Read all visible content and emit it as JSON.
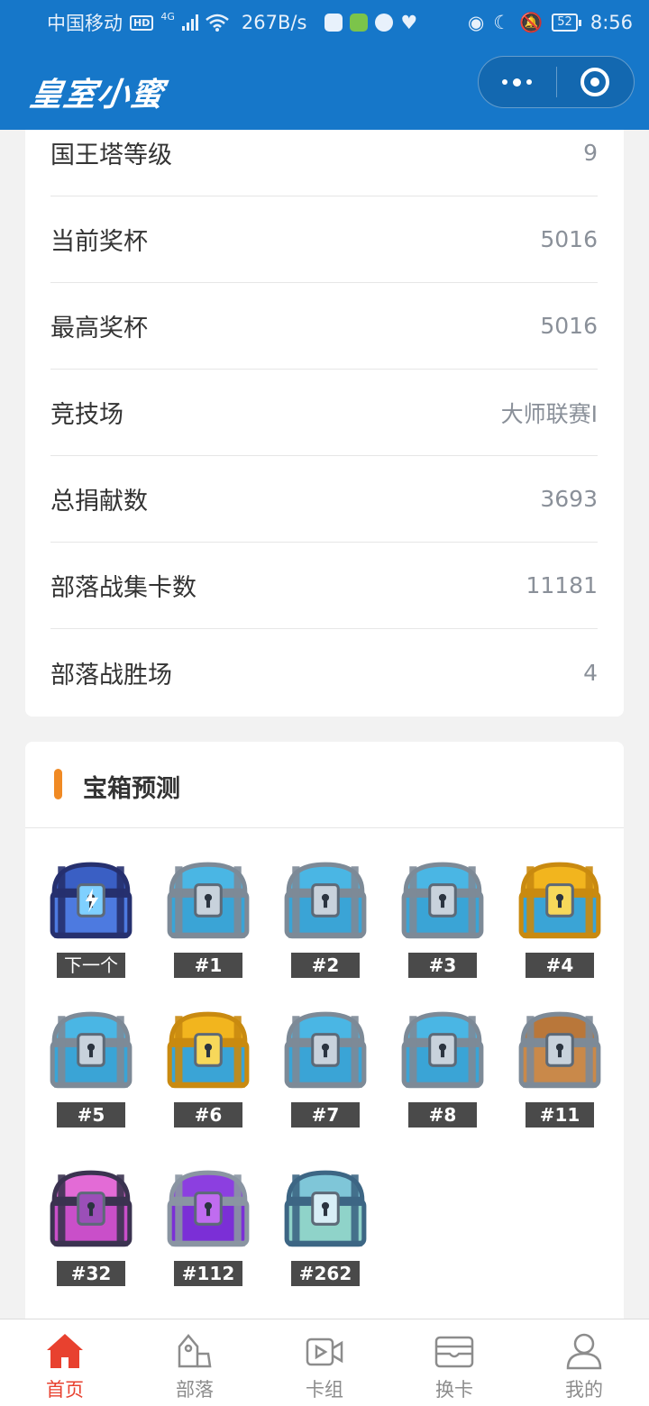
{
  "status_bar": {
    "carrier": "中国移动",
    "hd": "HD",
    "network": "4G",
    "speed": "267B/s",
    "battery": "52",
    "time": "8:56"
  },
  "title_bar": {
    "logo_text": "皇室小蜜",
    "more_icon": "more-dots-icon",
    "close_icon": "target-circle-icon"
  },
  "stats": [
    {
      "label": "国王塔等级",
      "value": "9"
    },
    {
      "label": "当前奖杯",
      "value": "5016"
    },
    {
      "label": "最高奖杯",
      "value": "5016"
    },
    {
      "label": "竞技场",
      "value": "大师联赛I"
    },
    {
      "label": "总捐献数",
      "value": "3693"
    },
    {
      "label": "部落战集卡数",
      "value": "11181"
    },
    {
      "label": "部落战胜场",
      "value": "4"
    }
  ],
  "chest_section": {
    "title": "宝箱预测",
    "accent_color": "#f08a24",
    "chests": [
      {
        "label": "下一个",
        "type": "lightning"
      },
      {
        "label": "#1",
        "type": "silver"
      },
      {
        "label": "#2",
        "type": "silver"
      },
      {
        "label": "#3",
        "type": "silver"
      },
      {
        "label": "#4",
        "type": "golden"
      },
      {
        "label": "#5",
        "type": "silver"
      },
      {
        "label": "#6",
        "type": "golden"
      },
      {
        "label": "#7",
        "type": "silver"
      },
      {
        "label": "#8",
        "type": "silver"
      },
      {
        "label": "#11",
        "type": "wooden"
      },
      {
        "label": "#32",
        "type": "magical"
      },
      {
        "label": "#112",
        "type": "giant"
      },
      {
        "label": "#262",
        "type": "legendary"
      }
    ]
  },
  "tab_bar": {
    "active_color": "#e8412f",
    "tabs": [
      {
        "label": "首页",
        "icon": "home-icon",
        "active": true
      },
      {
        "label": "部落",
        "icon": "clan-icon",
        "active": false
      },
      {
        "label": "卡组",
        "icon": "video-deck-icon",
        "active": false
      },
      {
        "label": "换卡",
        "icon": "card-wallet-icon",
        "active": false
      },
      {
        "label": "我的",
        "icon": "user-icon",
        "active": false
      }
    ]
  },
  "colors": {
    "header_blue": "#1677c9",
    "page_bg": "#f2f2f2"
  }
}
